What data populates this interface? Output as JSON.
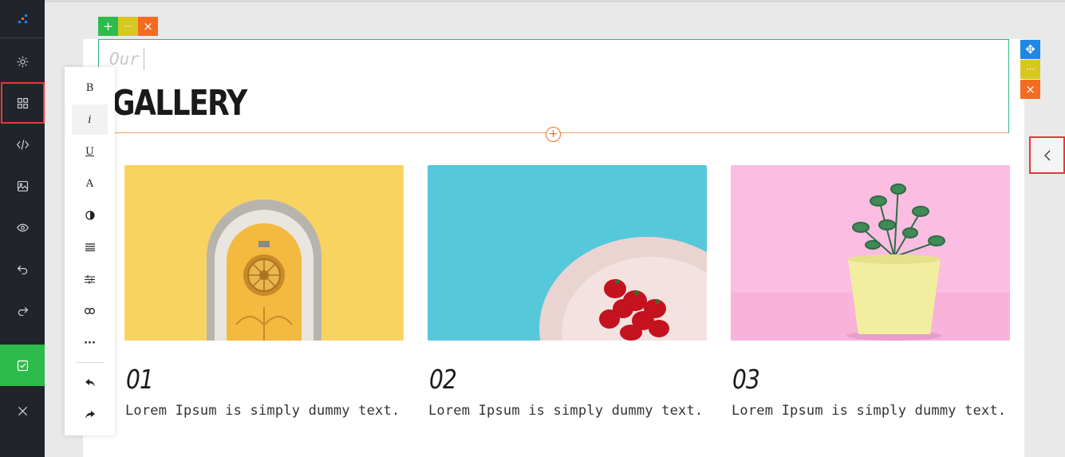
{
  "sidebar": {
    "items": [
      {
        "name": "logo-icon"
      },
      {
        "name": "settings-icon"
      },
      {
        "name": "blocks-grid-icon"
      },
      {
        "name": "code-icon"
      },
      {
        "name": "image-icon"
      },
      {
        "name": "preview-eye-icon"
      },
      {
        "name": "undo-icon"
      },
      {
        "name": "redo-icon"
      },
      {
        "name": "save-check-icon"
      },
      {
        "name": "close-icon"
      }
    ],
    "highlight_color": "#e53935",
    "save_color": "#2dbb4b"
  },
  "block_controls": {
    "add_label": "+",
    "more_label": "···",
    "delete_label": "×",
    "move_label": "✥"
  },
  "heading": {
    "subtitle": "Our",
    "title": "GALLERY",
    "add_label": "+"
  },
  "text_toolbar": {
    "bold": "B",
    "italic": "i",
    "underline": "U",
    "font": "A",
    "more": "···"
  },
  "gallery": {
    "cards": [
      {
        "number": "01",
        "text": "Lorem Ipsum is simply dummy text.",
        "image": "yellow-door"
      },
      {
        "number": "02",
        "text": "Lorem Ipsum is simply dummy text.",
        "image": "strawberries-plate"
      },
      {
        "number": "03",
        "text": "Lorem Ipsum is simply dummy text.",
        "image": "potted-plant"
      }
    ]
  },
  "colors": {
    "accent_green": "#2dbb4b",
    "accent_yellow": "#d6c81f",
    "accent_orange": "#f36c21",
    "accent_blue": "#1e88e5"
  }
}
